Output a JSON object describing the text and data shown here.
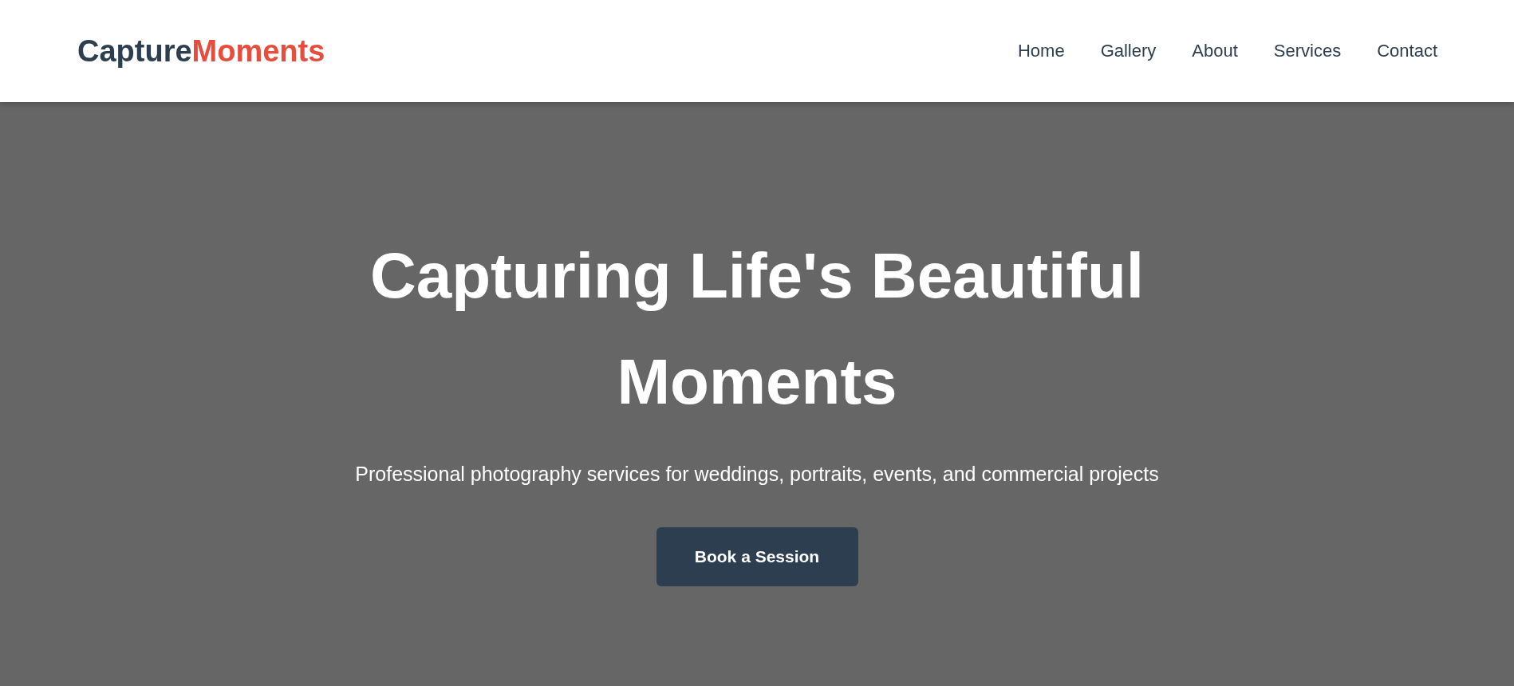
{
  "header": {
    "logo": {
      "primary": "Capture",
      "accent": "Moments"
    },
    "nav": [
      {
        "label": "Home"
      },
      {
        "label": "Gallery"
      },
      {
        "label": "About"
      },
      {
        "label": "Services"
      },
      {
        "label": "Contact"
      }
    ]
  },
  "hero": {
    "title": "Capturing Life's Beautiful Moments",
    "subtitle": "Professional photography services for weddings, portraits, events, and commercial projects",
    "button": "Book a Session"
  }
}
